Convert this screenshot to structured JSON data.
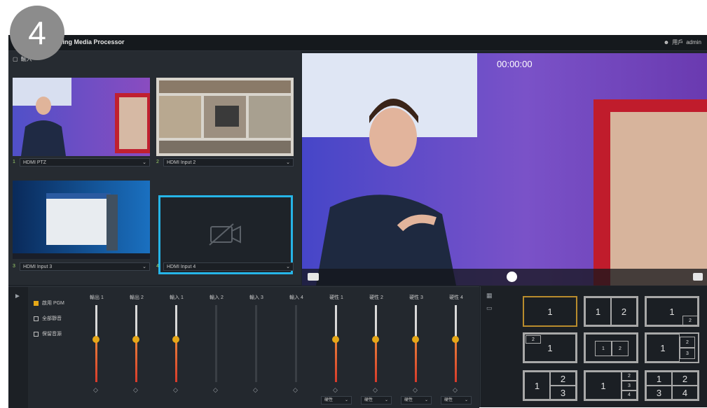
{
  "step_badge": "4",
  "window": {
    "title": "...ming Media Processor",
    "user_label": "admin",
    "user_prefix": "用戶"
  },
  "inputs": {
    "header": "輸入",
    "items": [
      {
        "index": "1",
        "label": "HDMI PTZ"
      },
      {
        "index": "2",
        "label": "HDMI Input 2"
      },
      {
        "index": "3",
        "label": "HDMI Input 3"
      },
      {
        "index": "4",
        "label": "HDMI Input 4"
      }
    ]
  },
  "preview": {
    "timecode": "00:00:00"
  },
  "audio": {
    "options": [
      {
        "label": "啟用 PGM",
        "checked": true
      },
      {
        "label": "全部靜音",
        "checked": false
      },
      {
        "label": "保留音源",
        "checked": false
      }
    ],
    "channels": [
      {
        "label": "輸出 1",
        "level": 0.55,
        "active": true
      },
      {
        "label": "輸出 2",
        "level": 0.55,
        "active": true
      },
      {
        "label": "輸入 1",
        "level": 0.55,
        "active": true
      },
      {
        "label": "輸入 2",
        "level": 0,
        "active": false
      },
      {
        "label": "輸入 3",
        "level": 0,
        "active": false
      },
      {
        "label": "輸入 4",
        "level": 0,
        "active": false
      },
      {
        "label": "硬性 1",
        "level": 0.55,
        "active": true,
        "dropdown": "硬性"
      },
      {
        "label": "硬性 2",
        "level": 0.55,
        "active": true,
        "dropdown": "硬性"
      },
      {
        "label": "硬性 3",
        "level": 0.55,
        "active": true,
        "dropdown": "硬性"
      },
      {
        "label": "硬性 4",
        "level": 0.55,
        "active": true,
        "dropdown": "硬性"
      }
    ]
  },
  "layouts": {
    "selected": 0,
    "labels": [
      "1",
      "2",
      "3",
      "4"
    ]
  },
  "colors": {
    "accent": "#e6a817",
    "selection": "#26b5e8",
    "meter_red": "#d93a2b"
  }
}
